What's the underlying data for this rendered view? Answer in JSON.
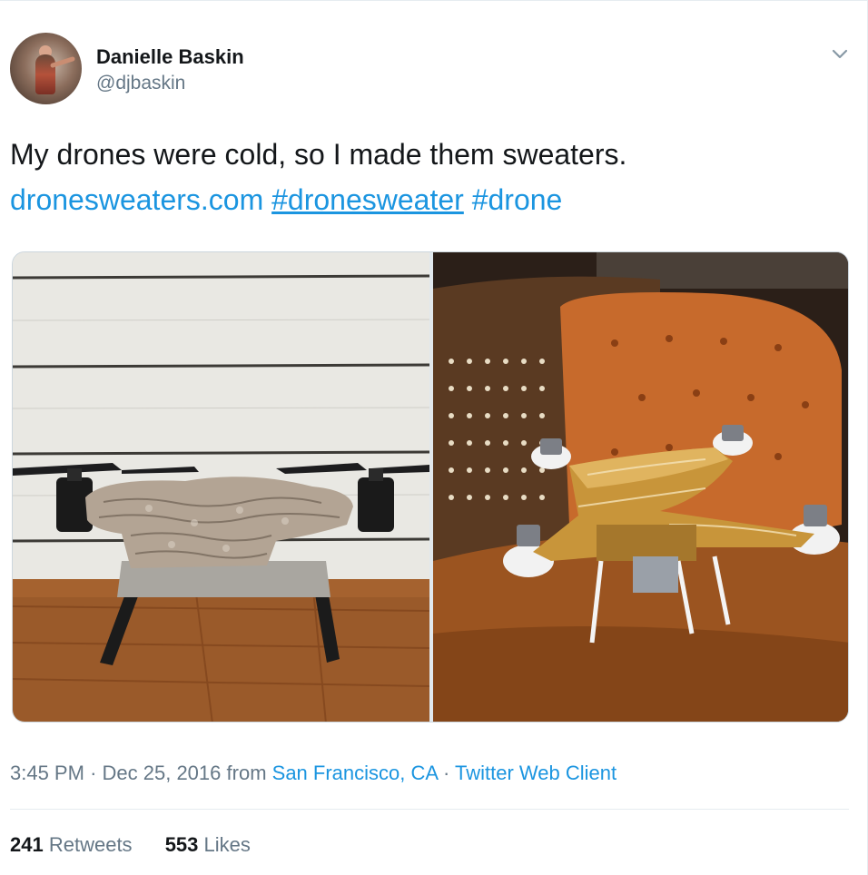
{
  "author": {
    "name": "Danielle Baskin",
    "handle": "@djbaskin"
  },
  "tweet": {
    "text": "My drones were cold, so I made them sweaters.",
    "link_text": "dronesweaters.com",
    "hashtag_1": "#dronesweater",
    "hashtag_2": "#drone"
  },
  "media": {
    "image_left": "drone in knit sweater on wooden table",
    "image_right": "white drone in orange sweater on orange chair"
  },
  "meta": {
    "time": "3:45 PM",
    "separator_1": "·",
    "date": "Dec 25, 2016",
    "from_label": "from",
    "location": "San Francisco, CA",
    "separator_2": "·",
    "client": "Twitter Web Client"
  },
  "stats": {
    "retweets_count": "241",
    "retweets_label": "Retweets",
    "likes_count": "553",
    "likes_label": "Likes"
  },
  "colors": {
    "link": "#1b95e0",
    "secondary_text": "#657786",
    "primary_text": "#14171a"
  },
  "icons": {
    "more": "chevron-down-icon"
  }
}
